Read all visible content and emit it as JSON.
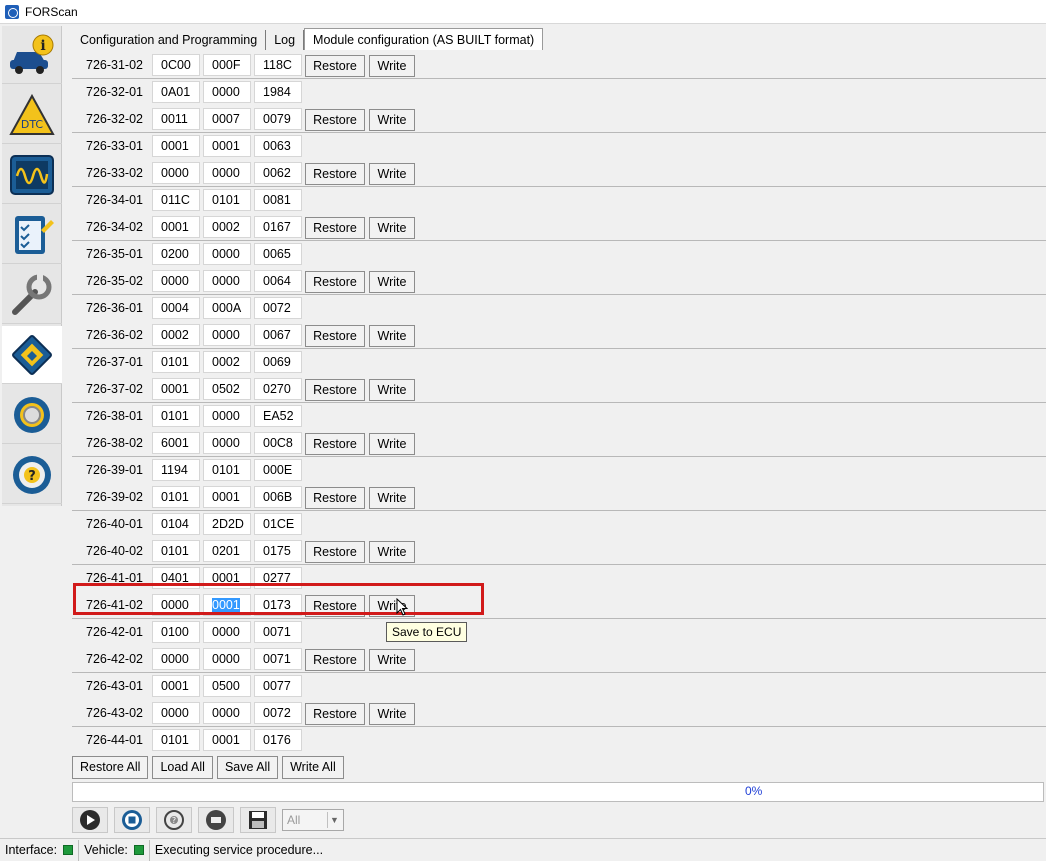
{
  "window": {
    "title": "FORScan"
  },
  "sidebar": {
    "items": [
      {
        "name": "vehicle-info-icon"
      },
      {
        "name": "dtc-icon",
        "label": "DTC"
      },
      {
        "name": "oscilloscope-icon"
      },
      {
        "name": "checklist-icon"
      },
      {
        "name": "wrench-icon"
      },
      {
        "name": "chip-config-icon"
      },
      {
        "name": "gear-icon"
      },
      {
        "name": "help-icon",
        "label": "?"
      }
    ]
  },
  "tabs": [
    {
      "label": "Configuration and Programming"
    },
    {
      "label": "Log"
    },
    {
      "label": "Module configuration (AS BUILT format)",
      "active": true
    }
  ],
  "rows": [
    {
      "id": "726-31-02",
      "v": [
        "0C00",
        "000F",
        "118C"
      ],
      "buttons": true
    },
    {
      "id": "726-32-01",
      "v": [
        "0A01",
        "0000",
        "1984"
      ],
      "buttons": false
    },
    {
      "id": "726-32-02",
      "v": [
        "0011",
        "0007",
        "0079"
      ],
      "buttons": true
    },
    {
      "id": "726-33-01",
      "v": [
        "0001",
        "0001",
        "0063"
      ],
      "buttons": false
    },
    {
      "id": "726-33-02",
      "v": [
        "0000",
        "0000",
        "0062"
      ],
      "buttons": true
    },
    {
      "id": "726-34-01",
      "v": [
        "011C",
        "0101",
        "0081"
      ],
      "buttons": false
    },
    {
      "id": "726-34-02",
      "v": [
        "0001",
        "0002",
        "0167"
      ],
      "buttons": true
    },
    {
      "id": "726-35-01",
      "v": [
        "0200",
        "0000",
        "0065"
      ],
      "buttons": false
    },
    {
      "id": "726-35-02",
      "v": [
        "0000",
        "0000",
        "0064"
      ],
      "buttons": true
    },
    {
      "id": "726-36-01",
      "v": [
        "0004",
        "000A",
        "0072"
      ],
      "buttons": false
    },
    {
      "id": "726-36-02",
      "v": [
        "0002",
        "0000",
        "0067"
      ],
      "buttons": true
    },
    {
      "id": "726-37-01",
      "v": [
        "0101",
        "0002",
        "0069"
      ],
      "buttons": false
    },
    {
      "id": "726-37-02",
      "v": [
        "0001",
        "0502",
        "0270"
      ],
      "buttons": true
    },
    {
      "id": "726-38-01",
      "v": [
        "0101",
        "0000",
        "EA52"
      ],
      "buttons": false
    },
    {
      "id": "726-38-02",
      "v": [
        "6001",
        "0000",
        "00C8"
      ],
      "buttons": true
    },
    {
      "id": "726-39-01",
      "v": [
        "1194",
        "0101",
        "000E"
      ],
      "buttons": false
    },
    {
      "id": "726-39-02",
      "v": [
        "0101",
        "0001",
        "006B"
      ],
      "buttons": true
    },
    {
      "id": "726-40-01",
      "v": [
        "0104",
        "2D2D",
        "01CE"
      ],
      "buttons": false
    },
    {
      "id": "726-40-02",
      "v": [
        "0101",
        "0201",
        "0175"
      ],
      "buttons": true
    },
    {
      "id": "726-41-01",
      "v": [
        "0401",
        "0001",
        "0277"
      ],
      "buttons": false
    },
    {
      "id": "726-41-02",
      "v": [
        "0000",
        "0001",
        "0173"
      ],
      "buttons": true,
      "selected_cell": 1
    },
    {
      "id": "726-42-01",
      "v": [
        "0100",
        "0000",
        "0071"
      ],
      "buttons": false
    },
    {
      "id": "726-42-02",
      "v": [
        "0000",
        "0000",
        "0071"
      ],
      "buttons": true
    },
    {
      "id": "726-43-01",
      "v": [
        "0001",
        "0500",
        "0077"
      ],
      "buttons": false
    },
    {
      "id": "726-43-02",
      "v": [
        "0000",
        "0000",
        "0072"
      ],
      "buttons": true
    },
    {
      "id": "726-44-01",
      "v": [
        "0101",
        "0001",
        "0176"
      ],
      "buttons": false
    }
  ],
  "row_buttons": {
    "restore": "Restore",
    "write": "Write"
  },
  "tooltip": {
    "text": "Save to ECU"
  },
  "bottom_buttons": [
    "Restore All",
    "Load All",
    "Save All",
    "Write All"
  ],
  "progress": {
    "text": "0%",
    "value": 0
  },
  "toolbar": {
    "icons": [
      "play-icon",
      "stop-icon",
      "connect-icon",
      "disconnect-icon",
      "save-icon"
    ],
    "filter": {
      "value": "All"
    }
  },
  "status": {
    "interface_label": "Interface:",
    "vehicle_label": "Vehicle:",
    "message": "Executing service procedure..."
  },
  "colors": {
    "highlight": "#d11a1a",
    "selection": "#3399ff",
    "status_led": "#1f9a3c",
    "progress_text": "#1f3fd6"
  }
}
